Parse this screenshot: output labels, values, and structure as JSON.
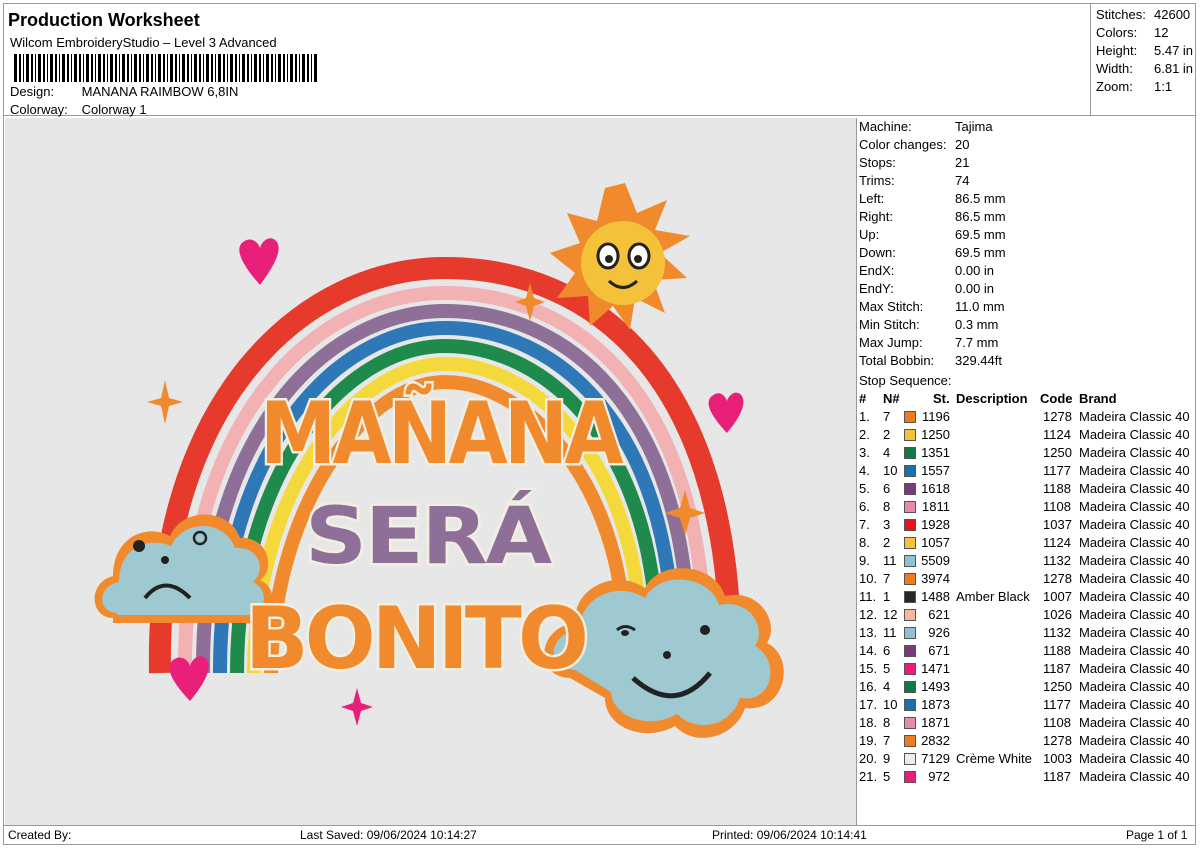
{
  "header": {
    "title": "Production Worksheet",
    "software": "Wilcom EmbroideryStudio – Level 3 Advanced",
    "design_label": "Design:",
    "design_value": "MANANA RAIMBOW 6,8IN",
    "colorway_label": "Colorway:",
    "colorway_value": "Colorway 1"
  },
  "stats": [
    {
      "label": "Stitches:",
      "value": "42600"
    },
    {
      "label": "Colors:",
      "value": "12"
    },
    {
      "label": "Height:",
      "value": "5.47 in"
    },
    {
      "label": "Width:",
      "value": "6.81 in"
    },
    {
      "label": "Zoom:",
      "value": "1:1"
    }
  ],
  "machine_info": [
    {
      "label": "Machine:",
      "value": "Tajima"
    },
    {
      "label": "Color changes:",
      "value": "20"
    },
    {
      "label": "Stops:",
      "value": "21"
    },
    {
      "label": "Trims:",
      "value": "74"
    },
    {
      "label": "Left:",
      "value": "86.5 mm"
    },
    {
      "label": "Right:",
      "value": "86.5 mm"
    },
    {
      "label": "Up:",
      "value": "69.5 mm"
    },
    {
      "label": "Down:",
      "value": "69.5 mm"
    },
    {
      "label": "EndX:",
      "value": "0.00 in"
    },
    {
      "label": "EndY:",
      "value": "0.00 in"
    },
    {
      "label": "Max Stitch:",
      "value": "11.0 mm"
    },
    {
      "label": "Min Stitch:",
      "value": "0.3 mm"
    },
    {
      "label": "Max Jump:",
      "value": "7.7 mm"
    },
    {
      "label": "Total Bobbin:",
      "value": "329.44ft"
    }
  ],
  "stop_sequence": {
    "label": "Stop Sequence:",
    "headers": {
      "num": "#",
      "n": "N#",
      "st": "St.",
      "description": "Description",
      "code": "Code",
      "brand": "Brand"
    },
    "rows": [
      {
        "idx": "1.",
        "n": "7",
        "color": "#f07a1e",
        "st": "1196",
        "desc": "",
        "code": "1278",
        "brand": "Madeira Classic 40"
      },
      {
        "idx": "2.",
        "n": "2",
        "color": "#f7c23a",
        "st": "1250",
        "desc": "",
        "code": "1124",
        "brand": "Madeira Classic 40"
      },
      {
        "idx": "3.",
        "n": "4",
        "color": "#0f7a45",
        "st": "1351",
        "desc": "",
        "code": "1250",
        "brand": "Madeira Classic 40"
      },
      {
        "idx": "4.",
        "n": "10",
        "color": "#1a6fb0",
        "st": "1557",
        "desc": "",
        "code": "1177",
        "brand": "Madeira Classic 40"
      },
      {
        "idx": "5.",
        "n": "6",
        "color": "#7a3a7c",
        "st": "1618",
        "desc": "",
        "code": "1188",
        "brand": "Madeira Classic 40"
      },
      {
        "idx": "6.",
        "n": "8",
        "color": "#e98aa2",
        "st": "1811",
        "desc": "",
        "code": "1108",
        "brand": "Madeira Classic 40"
      },
      {
        "idx": "7.",
        "n": "3",
        "color": "#e8121c",
        "st": "1928",
        "desc": "",
        "code": "1037",
        "brand": "Madeira Classic 40"
      },
      {
        "idx": "8.",
        "n": "2",
        "color": "#f7c23a",
        "st": "1057",
        "desc": "",
        "code": "1124",
        "brand": "Madeira Classic 40"
      },
      {
        "idx": "9.",
        "n": "11",
        "color": "#8ec1d6",
        "st": "5509",
        "desc": "",
        "code": "1132",
        "brand": "Madeira Classic 40"
      },
      {
        "idx": "10.",
        "n": "7",
        "color": "#f07a1e",
        "st": "3974",
        "desc": "",
        "code": "1278",
        "brand": "Madeira Classic 40"
      },
      {
        "idx": "11.",
        "n": "1",
        "color": "#262626",
        "st": "1488",
        "desc": "Amber Black",
        "code": "1007",
        "brand": "Madeira Classic 40"
      },
      {
        "idx": "12.",
        "n": "12",
        "color": "#f6b79a",
        "st": "621",
        "desc": "",
        "code": "1026",
        "brand": "Madeira Classic 40"
      },
      {
        "idx": "13.",
        "n": "11",
        "color": "#8ec1d6",
        "st": "926",
        "desc": "",
        "code": "1132",
        "brand": "Madeira Classic 40"
      },
      {
        "idx": "14.",
        "n": "6",
        "color": "#7a3a7c",
        "st": "671",
        "desc": "",
        "code": "1188",
        "brand": "Madeira Classic 40"
      },
      {
        "idx": "15.",
        "n": "5",
        "color": "#ee1b7a",
        "st": "1471",
        "desc": "",
        "code": "1187",
        "brand": "Madeira Classic 40"
      },
      {
        "idx": "16.",
        "n": "4",
        "color": "#0f7a45",
        "st": "1493",
        "desc": "",
        "code": "1250",
        "brand": "Madeira Classic 40"
      },
      {
        "idx": "17.",
        "n": "10",
        "color": "#1a6fb0",
        "st": "1873",
        "desc": "",
        "code": "1177",
        "brand": "Madeira Classic 40"
      },
      {
        "idx": "18.",
        "n": "8",
        "color": "#e98aa2",
        "st": "1871",
        "desc": "",
        "code": "1108",
        "brand": "Madeira Classic 40"
      },
      {
        "idx": "19.",
        "n": "7",
        "color": "#f07a1e",
        "st": "2832",
        "desc": "",
        "code": "1278",
        "brand": "Madeira Classic 40"
      },
      {
        "idx": "20.",
        "n": "9",
        "color": "#ececec",
        "st": "7129",
        "desc": "Crème White",
        "code": "1003",
        "brand": "Madeira Classic 40"
      },
      {
        "idx": "21.",
        "n": "5",
        "color": "#ee1b7a",
        "st": "972",
        "desc": "",
        "code": "1187",
        "brand": "Madeira Classic 40"
      }
    ]
  },
  "artwork": {
    "line1": "MAÑANA",
    "line2": "SERÁ",
    "line3": "BONITO"
  },
  "footer": {
    "created_by": "Created By:",
    "last_saved": "Last Saved: 09/06/2024 10:14:27",
    "printed": "Printed: 09/06/2024 10:14:41",
    "page": "Page 1 of 1"
  }
}
